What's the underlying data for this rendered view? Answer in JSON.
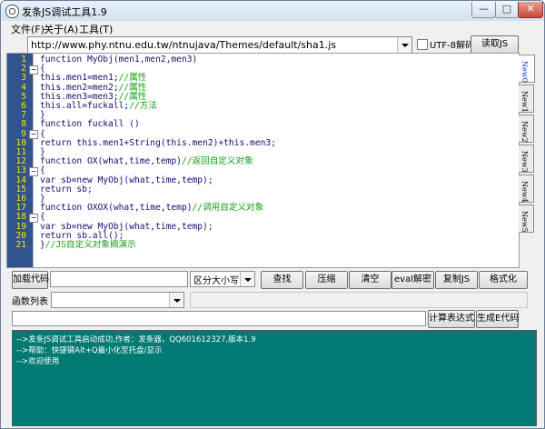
{
  "window": {
    "title": "发条JS调试工具1.9",
    "controls": {
      "minimize": "—",
      "maximize": "□",
      "close": "✕"
    }
  },
  "menu": [
    "文件(F)",
    "关于(A)",
    "工具(T)"
  ],
  "toolbar": {
    "url_value": "http://www.phy.ntnu.edu.tw/ntnujava/Themes/default/sha1.js",
    "utf8_label": "UTF-8解码",
    "utf8_checked": false,
    "read_js_label": "读取JS"
  },
  "editor": {
    "line_numbers": [
      "1",
      "2",
      "3",
      "4",
      "5",
      "6",
      "7",
      "8",
      "9",
      "10",
      "11",
      "12",
      "13",
      "14",
      "15",
      "16",
      "17",
      "18",
      "19",
      "20",
      "21"
    ],
    "lines": [
      [
        {
          "t": "function MyObj(men1,men2,men3)",
          "c": "#10106e"
        }
      ],
      [
        {
          "t": "{",
          "c": "#10106e"
        }
      ],
      [
        {
          "t": "this.men1=men1;",
          "c": "#10106e"
        },
        {
          "t": "//属性",
          "c": "#16a116"
        }
      ],
      [
        {
          "t": "this.men2=men2;",
          "c": "#10106e"
        },
        {
          "t": "//属性",
          "c": "#16a116"
        }
      ],
      [
        {
          "t": "this.men3=men3;",
          "c": "#10106e"
        },
        {
          "t": "//属性",
          "c": "#16a116"
        }
      ],
      [
        {
          "t": "this.all=fuckall;",
          "c": "#10106e"
        },
        {
          "t": "//方法",
          "c": "#16a116"
        }
      ],
      [
        {
          "t": "}",
          "c": "#10106e"
        }
      ],
      [
        {
          "t": "function fuckall ()",
          "c": "#10106e"
        }
      ],
      [
        {
          "t": "{",
          "c": "#10106e"
        }
      ],
      [
        {
          "t": "return this.men1+String(this.men2)+this.men3;",
          "c": "#10106e"
        }
      ],
      [
        {
          "t": "}",
          "c": "#10106e"
        }
      ],
      [
        {
          "t": "function OX(what,time,temp)",
          "c": "#10106e"
        },
        {
          "t": "//返回自定义对象",
          "c": "#16a116"
        }
      ],
      [
        {
          "t": "{",
          "c": "#10106e"
        }
      ],
      [
        {
          "t": "var sb=new MyObj(what,time,temp);",
          "c": "#10106e"
        }
      ],
      [
        {
          "t": "return sb;",
          "c": "#10106e"
        }
      ],
      [
        {
          "t": "}",
          "c": "#10106e"
        }
      ],
      [
        {
          "t": "function OXOX(what,time,temp)",
          "c": "#10106e"
        },
        {
          "t": "//调用自定义对象",
          "c": "#16a116"
        }
      ],
      [
        {
          "t": "{",
          "c": "#10106e"
        }
      ],
      [
        {
          "t": "var sb=new MyObj(what,time,temp);",
          "c": "#10106e"
        }
      ],
      [
        {
          "t": "return sb.all();",
          "c": "#10106e"
        }
      ],
      [
        {
          "t": "}",
          "c": "#10106e"
        },
        {
          "t": "//JS自定义对象摘演示",
          "c": "#16a116"
        }
      ]
    ]
  },
  "tabs": [
    "New0",
    "New1",
    "New2",
    "New3",
    "New4",
    "New5"
  ],
  "actions": {
    "load_code": "加载代码",
    "case_option": "区分大小写",
    "find": "查找",
    "compress": "压缩",
    "clear": "清空",
    "eval_decrypt": "eval解密",
    "copy_js": "复制JS",
    "format": "格式化",
    "func_list_label": "函数列表",
    "calc_expr": "计算表达式",
    "gen_e_code": "生成E代码"
  },
  "console": {
    "lines": [
      "-->发条JS调试工具启动成功,作者：发条器，QQ601612327,版本1.9",
      "-->帮助：快捷键Alt+Q最小化至托盘/显示",
      "-->欢迎使用"
    ]
  },
  "colors": {
    "gutter": "#31538e",
    "line_numbers": "#ffe600",
    "code": "#10106e",
    "comment": "#16a116",
    "console_bg": "#007a72"
  }
}
